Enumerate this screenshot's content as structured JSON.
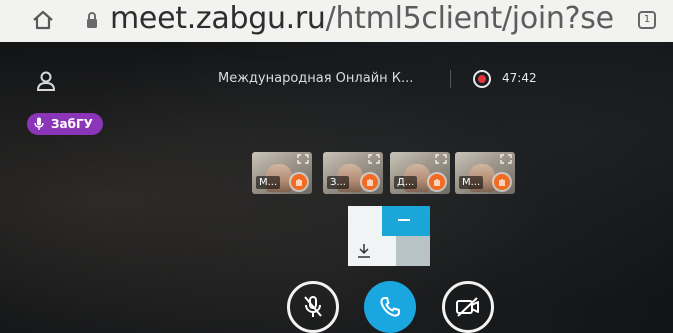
{
  "browser": {
    "url_host": "meet.zabgu.ru",
    "url_path": "/html5client/join?se",
    "tabs_count": "1"
  },
  "meeting": {
    "title": "Международная Онлайн К...",
    "timer": "47:42"
  },
  "talking": {
    "name": "ЗабГУ"
  },
  "webcams": [
    {
      "label": "М..."
    },
    {
      "label": "З..."
    },
    {
      "label": "Д..."
    },
    {
      "label": "М..."
    }
  ],
  "colors": {
    "accent_blue": "#1aa7e0",
    "talking_purple": "#8b35b8",
    "record_red": "#e5333b",
    "badge_orange": "#f26b21"
  },
  "icons": {
    "home": "home-icon",
    "lock": "lock-icon",
    "tabs": "tabs-icon",
    "user": "user-icon",
    "record": "record-icon",
    "mic": "microphone-icon",
    "download": "download-icon",
    "mute": "muted-microphone-icon",
    "phone": "phone-icon",
    "camera_off": "camera-off-icon"
  }
}
